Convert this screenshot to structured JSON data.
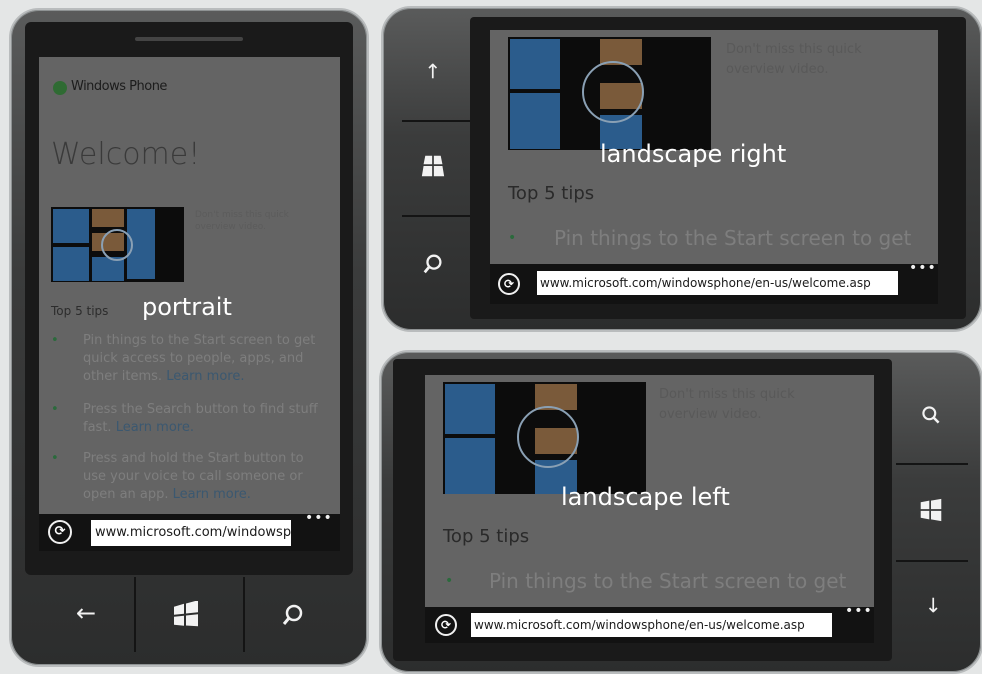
{
  "portrait": {
    "caption": "portrait",
    "logo_text": "Windows Phone",
    "heading": "Welcome!",
    "video_blurb": "Don't miss this quick overview video.",
    "tips_heading": "Top 5 tips",
    "tips": [
      {
        "text": "Pin things to the Start screen to get quick access to people, apps, and other items.",
        "link": "Learn more."
      },
      {
        "text": "Press the Search button to find stuff fast.",
        "link": "Learn more."
      },
      {
        "text": "Press and hold the Start button to use your voice to call someone or open an app.",
        "link": "Learn more."
      }
    ],
    "url": "www.microsoft.com/windowsphone/en-us/welcome.asp",
    "more": "•••",
    "buttons": {
      "back": "←",
      "start": "start-icon",
      "search": "search-icon"
    }
  },
  "landscape_right": {
    "caption": "landscape right",
    "video_blurb": "Don't miss this quick overview video.",
    "tips_heading": "Top 5 tips",
    "tip1": "Pin things to the Start screen to get",
    "url": "www.microsoft.com/windowsphone/en-us/welcome.asp",
    "more": "•••",
    "buttons": {
      "back": "←",
      "start": "start-icon",
      "search": "search-icon"
    }
  },
  "landscape_left": {
    "caption": "landscape left",
    "video_blurb": "Don't miss this quick overview video.",
    "tips_heading": "Top 5 tips",
    "tip1": "Pin things to the Start screen to get",
    "url": "www.microsoft.com/windowsphone/en-us/welcome.asp",
    "more": "•••",
    "buttons": {
      "search": "search-icon",
      "start": "start-icon",
      "back": "←"
    }
  }
}
